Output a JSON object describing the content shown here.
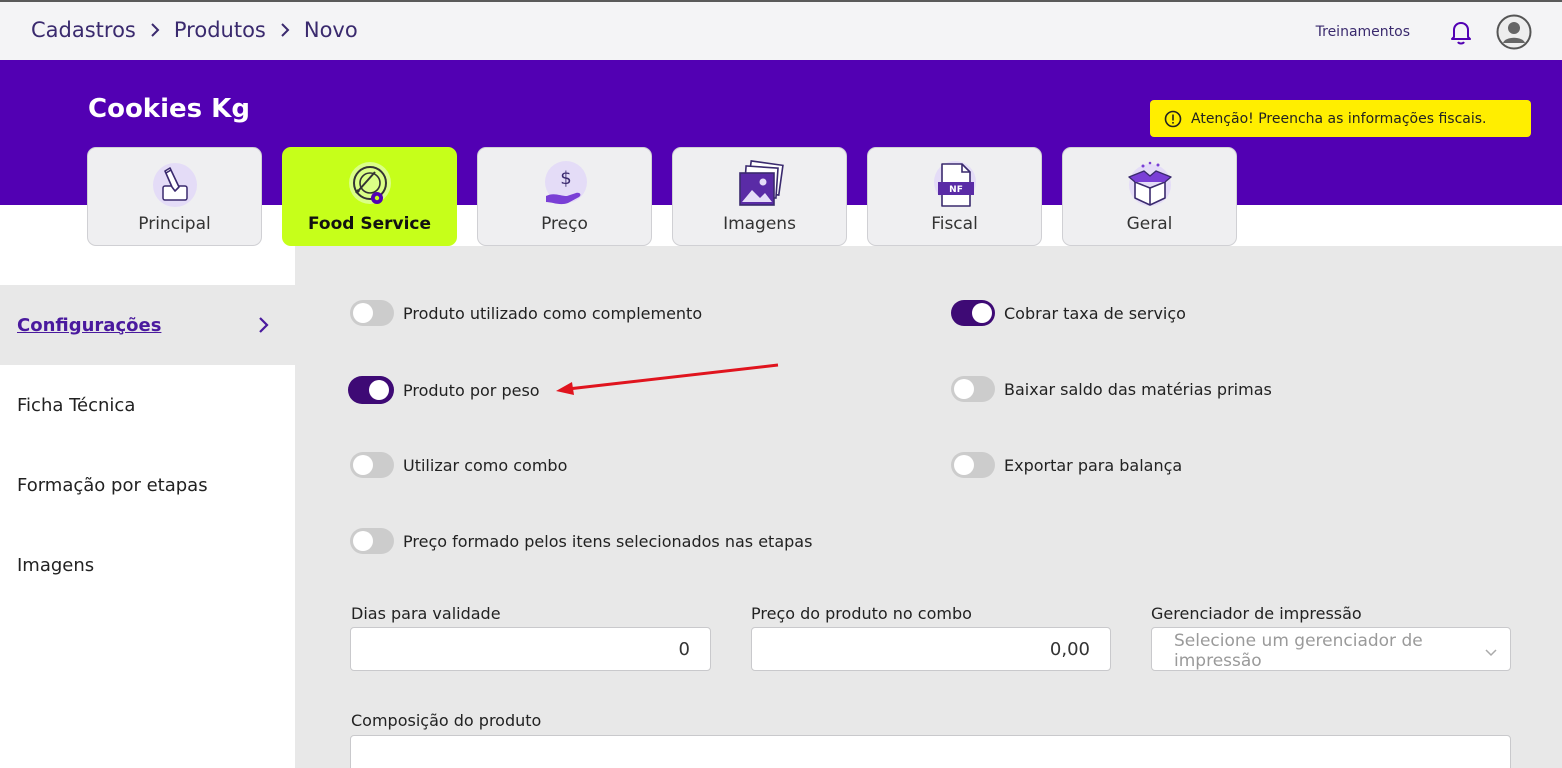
{
  "breadcrumb": [
    "Cadastros",
    "Produtos",
    "Novo"
  ],
  "top": {
    "training_link": "Treinamentos"
  },
  "product": {
    "name": "Cookies Kg"
  },
  "warning": {
    "text": "Atenção! Preencha as informações fiscais."
  },
  "tabs": [
    {
      "label": "Principal",
      "icon": "pencil-icon",
      "active": false
    },
    {
      "label": "Food Service",
      "icon": "plate-gear-icon",
      "active": true
    },
    {
      "label": "Preço",
      "icon": "hand-dollar-icon",
      "active": false
    },
    {
      "label": "Imagens",
      "icon": "images-icon",
      "active": false
    },
    {
      "label": "Fiscal",
      "icon": "nf-document-icon",
      "active": false
    },
    {
      "label": "Geral",
      "icon": "box-icon",
      "active": false
    }
  ],
  "sidebar": {
    "items": [
      {
        "label": "Configurações",
        "active": true
      },
      {
        "label": "Ficha Técnica",
        "active": false
      },
      {
        "label": "Formação por etapas",
        "active": false
      },
      {
        "label": "Imagens",
        "active": false
      }
    ]
  },
  "toggles": {
    "complemento": {
      "label": "Produto utilizado como complemento",
      "on": false
    },
    "peso": {
      "label": "Produto por peso",
      "on": true
    },
    "combo": {
      "label": "Utilizar como combo",
      "on": false
    },
    "preco_etapas": {
      "label": "Preço formado pelos itens selecionados nas etapas",
      "on": false
    },
    "taxa_servico": {
      "label": "Cobrar taxa de serviço",
      "on": true
    },
    "baixar_saldo": {
      "label": "Baixar saldo das matérias primas",
      "on": false
    },
    "exportar_balanca": {
      "label": "Exportar para balança",
      "on": false
    }
  },
  "fields": {
    "validade": {
      "label": "Dias para validade",
      "value": "0"
    },
    "preco_combo": {
      "label": "Preço do produto no combo",
      "value": "0,00"
    },
    "gerenciador": {
      "label": "Gerenciador de impressão",
      "placeholder": "Selecione um gerenciador de impressão"
    },
    "composicao": {
      "label": "Composição do produto",
      "value": ""
    }
  },
  "colors": {
    "header": "#5200b3",
    "active_tab": "#c6ff1a",
    "warning": "#ffee00",
    "toggle_on": "#3e0a75",
    "toggle_off": "#cccccc",
    "arrow": "#e0141e"
  }
}
